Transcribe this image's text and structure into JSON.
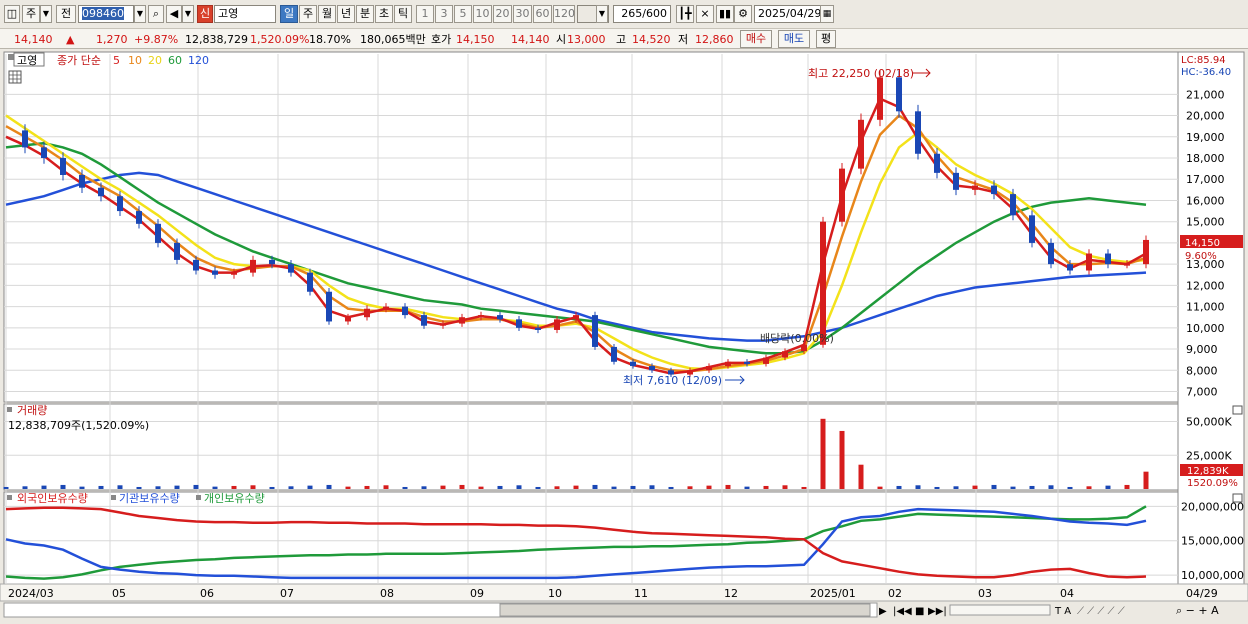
{
  "toolbar": {
    "market_type": "주",
    "prev_label": "전",
    "stock_code": "098460",
    "new_badge": "신",
    "stock_name": "고영",
    "periods": [
      "일",
      "주",
      "월",
      "년",
      "분",
      "초",
      "틱"
    ],
    "active_period": "일",
    "intervals": [
      "1",
      "3",
      "5",
      "10",
      "20",
      "30",
      "60",
      "120"
    ],
    "count_display": "265",
    "count_max": "/600",
    "date": "2025/04/29"
  },
  "quote": {
    "price": "14,140",
    "up_arrow": "▲",
    "change": "1,270",
    "change_pct": "+9.87%",
    "volume": "12,838,729",
    "volume_pct": "1,520.09%",
    "turnover": "18.70%",
    "amount": "180,065백만",
    "hoga_label": "호가",
    "hoga_price": "14,150",
    "hoga_price2": "14,140",
    "open_label": "시",
    "open": "13,000",
    "high_label": "고",
    "high": "14,520",
    "low_label": "저",
    "low": "12,860",
    "buy_label": "매수",
    "sell_label": "매도",
    "eval_label": "평"
  },
  "price_panel": {
    "stock_tag": "고영",
    "legend_prefix": "종가 단순",
    "ma_labels": [
      "5",
      "10",
      "20",
      "60",
      "120"
    ],
    "ma_colors": [
      "#d61d1d",
      "#e8861a",
      "#f3e21a",
      "#1f9a3a",
      "#2350d8"
    ],
    "lc": "LC:85.94",
    "hc": "HC:-36.40",
    "max_annotation": "최고 22,250 (02/18)",
    "min_annotation": "최저 7,610 (12/09)",
    "dividend_annotation": "배당락(0.00%)",
    "current_price_label": "14,150",
    "current_pct_label": "9.60%",
    "y_ticks": [
      "21,000",
      "20,000",
      "19,000",
      "18,000",
      "17,000",
      "16,000",
      "15,000",
      "14,000",
      "13,000",
      "12,000",
      "11,000",
      "10,000",
      "9,000",
      "8,000",
      "7,000"
    ]
  },
  "volume_panel": {
    "title": "거래량",
    "info": "12,838,709주(1,520.09%)",
    "y_ticks": [
      "50,000K",
      "25,000K"
    ],
    "current_label": "12,839K",
    "current_pct": "1520.09%"
  },
  "holding_panel": {
    "legend": [
      "외국인보유수량",
      "기관보유수량",
      "개인보유수량"
    ],
    "legend_colors": [
      "#d61d1d",
      "#2350d8",
      "#1f9a3a"
    ],
    "y_ticks": [
      "20,000,000",
      "15,000,000",
      "10,000,000"
    ]
  },
  "x_axis": {
    "labels": [
      "2024/03",
      "05",
      "06",
      "07",
      "08",
      "09",
      "10",
      "11",
      "12",
      "2025/01",
      "02",
      "03",
      "04"
    ],
    "end_label": "04/29"
  },
  "chart_data": {
    "type": "candlestick",
    "price": {
      "ylim": [
        6600,
        22900
      ],
      "close": [
        19300,
        18500,
        18000,
        17200,
        16600,
        16200,
        15500,
        14900,
        14000,
        13200,
        12700,
        12500,
        12600,
        13200,
        13000,
        12600,
        11700,
        10300,
        10500,
        10900,
        11000,
        10600,
        10100,
        10200,
        10500,
        10600,
        10400,
        10000,
        9900,
        10400,
        10600,
        9100,
        8400,
        8200,
        8000,
        7800,
        8000,
        8200,
        8400,
        8300,
        8600,
        8900,
        9200,
        15000,
        17500,
        19800,
        21800,
        20200,
        18200,
        17300,
        16500,
        16700,
        16300,
        15300,
        14000,
        13000,
        12700,
        13500,
        13000,
        13000,
        14140
      ],
      "ma5": [
        19000,
        18600,
        18100,
        17400,
        16800,
        16300,
        15700,
        15100,
        14300,
        13500,
        12900,
        12600,
        12600,
        12900,
        12950,
        12800,
        12000,
        10800,
        10500,
        10700,
        10900,
        10800,
        10300,
        10150,
        10350,
        10550,
        10450,
        10100,
        9950,
        10250,
        10500,
        9400,
        8600,
        8250,
        8050,
        7850,
        7950,
        8150,
        8350,
        8350,
        8550,
        8850,
        9200,
        13000,
        16200,
        18800,
        20800,
        20400,
        18900,
        17600,
        16700,
        16600,
        16400,
        15600,
        14400,
        13300,
        12800,
        13200,
        13100,
        13000,
        13500
      ],
      "ma10": [
        19500,
        19000,
        18500,
        17900,
        17200,
        16700,
        16200,
        15500,
        14800,
        14000,
        13300,
        12900,
        12700,
        12800,
        12900,
        12900,
        12500,
        11500,
        10900,
        10800,
        10800,
        10800,
        10500,
        10300,
        10300,
        10400,
        10400,
        10200,
        10000,
        10100,
        10300,
        9800,
        9000,
        8500,
        8200,
        8000,
        7950,
        8050,
        8200,
        8300,
        8450,
        8700,
        9000,
        11500,
        14300,
        16900,
        19100,
        20000,
        19400,
        18100,
        17100,
        16800,
        16500,
        15900,
        14900,
        13800,
        13000,
        13000,
        13050,
        13000,
        13300
      ],
      "ma20": [
        20000,
        19400,
        18800,
        18200,
        17600,
        17000,
        16500,
        15900,
        15300,
        14600,
        13900,
        13300,
        13000,
        12900,
        12900,
        12900,
        12700,
        12000,
        11400,
        11100,
        10900,
        10900,
        10700,
        10500,
        10400,
        10400,
        10400,
        10300,
        10100,
        10100,
        10200,
        10000,
        9500,
        9000,
        8600,
        8300,
        8100,
        8050,
        8150,
        8250,
        8350,
        8550,
        8800,
        9800,
        12000,
        14500,
        16800,
        18500,
        19200,
        18500,
        17700,
        17200,
        16800,
        16300,
        15600,
        14700,
        13800,
        13400,
        13200,
        13100,
        13200
      ],
      "ma60": [
        18500,
        18600,
        18700,
        18500,
        18200,
        17700,
        17100,
        16500,
        15900,
        15400,
        14900,
        14400,
        14000,
        13600,
        13300,
        13000,
        12700,
        12400,
        12100,
        11900,
        11700,
        11500,
        11300,
        11200,
        11100,
        10900,
        10800,
        10700,
        10600,
        10500,
        10400,
        10300,
        10100,
        9900,
        9700,
        9500,
        9300,
        9100,
        9000,
        8900,
        8800,
        8800,
        8900,
        9400,
        10000,
        10700,
        11400,
        12100,
        12800,
        13400,
        14000,
        14500,
        15000,
        15400,
        15700,
        15900,
        16000,
        16100,
        16000,
        15900,
        15800
      ],
      "ma120": [
        15800,
        16000,
        16200,
        16500,
        16800,
        17000,
        17200,
        17300,
        17200,
        16900,
        16600,
        16300,
        16000,
        15700,
        15400,
        15100,
        14800,
        14500,
        14200,
        13900,
        13600,
        13300,
        13000,
        12700,
        12400,
        12100,
        11800,
        11500,
        11200,
        10900,
        10700,
        10400,
        10200,
        10000,
        9800,
        9700,
        9600,
        9500,
        9450,
        9400,
        9400,
        9500,
        9600,
        9800,
        10000,
        10300,
        10600,
        10900,
        11200,
        11500,
        11700,
        11900,
        12000,
        12100,
        12200,
        12300,
        12400,
        12450,
        12500,
        12550,
        12600
      ],
      "max": 22250,
      "min": 7610
    },
    "volume": {
      "ylim": [
        0,
        60000
      ],
      "spikes": [
        {
          "i": 43,
          "v": 52000
        },
        {
          "i": 44,
          "v": 43000
        },
        {
          "i": 45,
          "v": 18000
        },
        {
          "i": 60,
          "v": 12839
        }
      ]
    },
    "holding": {
      "ylim": [
        9000000,
        21500000
      ],
      "foreign": [
        19600000,
        19700000,
        19800000,
        19800000,
        19700000,
        19600000,
        19100000,
        18600000,
        18300000,
        18000000,
        17800000,
        17700000,
        17700000,
        17600000,
        17600000,
        17700000,
        17700000,
        17600000,
        17600000,
        17500000,
        17500000,
        17500000,
        17400000,
        17400000,
        17400000,
        17400000,
        17300000,
        17300000,
        17200000,
        17200000,
        17100000,
        16900000,
        16600000,
        16300000,
        16100000,
        16000000,
        15900000,
        15800000,
        15700000,
        15600000,
        15500000,
        15300000,
        15200000,
        13200000,
        12000000,
        11500000,
        11000000,
        10500000,
        10100000,
        9900000,
        9800000,
        9700000,
        9700000,
        10000000,
        10500000,
        10800000,
        10900000,
        10300000,
        9800000,
        9700000,
        9800000
      ],
      "institution": [
        15200000,
        14600000,
        14300000,
        13700000,
        12400000,
        11200000,
        10800000,
        10500000,
        10300000,
        10200000,
        10000000,
        9900000,
        9900000,
        9800000,
        9700000,
        9600000,
        9600000,
        9600000,
        9600000,
        9600000,
        9600000,
        9600000,
        9600000,
        9600000,
        9600000,
        9600000,
        9600000,
        9600000,
        9600000,
        9600000,
        9700000,
        9900000,
        10100000,
        10300000,
        10500000,
        10700000,
        10900000,
        11100000,
        11200000,
        11300000,
        11300000,
        11400000,
        11500000,
        14500000,
        17800000,
        18400000,
        18600000,
        19200000,
        19600000,
        19500000,
        19400000,
        19300000,
        19200000,
        18900000,
        18600000,
        18200000,
        17800000,
        17600000,
        17500000,
        17300000,
        17900000
      ],
      "individual": [
        9800000,
        9600000,
        9500000,
        9700000,
        10100000,
        10700000,
        11200000,
        11500000,
        11800000,
        12000000,
        12200000,
        12300000,
        12500000,
        12600000,
        12700000,
        12800000,
        12900000,
        12900000,
        13000000,
        13000000,
        13100000,
        13100000,
        13100000,
        13100000,
        13200000,
        13300000,
        13400000,
        13500000,
        13700000,
        13800000,
        13900000,
        14000000,
        14100000,
        14100000,
        14200000,
        14200000,
        14300000,
        14400000,
        14500000,
        14700000,
        14800000,
        15000000,
        15200000,
        16400000,
        17100000,
        17900000,
        18100000,
        18500000,
        18900000,
        18800000,
        18700000,
        18600000,
        18500000,
        18400000,
        18300000,
        18200000,
        18100000,
        18100000,
        18200000,
        18400000,
        20000000
      ]
    }
  }
}
